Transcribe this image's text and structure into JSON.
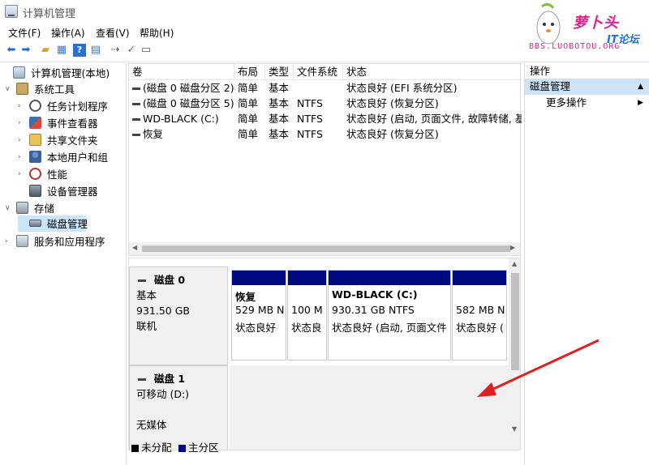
{
  "window": {
    "title": "计算机管理"
  },
  "brand": {
    "logo_main": "萝卜头",
    "logo_tag": "IT论坛",
    "url": "BBS.LUOBOTOU.ORG"
  },
  "menu": [
    "文件(F)",
    "操作(A)",
    "查看(V)",
    "帮助(H)"
  ],
  "toolbar_icons": [
    "back-icon",
    "forward-icon",
    "up-folder-icon",
    "show-hide-tree-icon",
    "help-icon",
    "properties-icon",
    "connect-icon",
    "check-icon",
    "export-icon"
  ],
  "tree": [
    {
      "label": "计算机管理(本地)",
      "icon": "computer-icon",
      "expander": "",
      "level": 0
    },
    {
      "label": "系统工具",
      "icon": "tools-icon",
      "expander": "∨",
      "level": 1
    },
    {
      "label": "任务计划程序",
      "icon": "clock-icon",
      "expander": "›",
      "level": 2
    },
    {
      "label": "事件查看器",
      "icon": "event-viewer-icon",
      "expander": "›",
      "level": 2
    },
    {
      "label": "共享文件夹",
      "icon": "shared-folder-icon",
      "expander": "›",
      "level": 2
    },
    {
      "label": "本地用户和组",
      "icon": "users-icon",
      "expander": "›",
      "level": 2
    },
    {
      "label": "性能",
      "icon": "performance-icon",
      "expander": "›",
      "level": 2
    },
    {
      "label": "设备管理器",
      "icon": "device-manager-icon",
      "expander": "",
      "level": 2
    },
    {
      "label": "存储",
      "icon": "storage-icon",
      "expander": "∨",
      "level": 1
    },
    {
      "label": "磁盘管理",
      "icon": "disk-management-icon",
      "expander": "",
      "level": 2,
      "selected": true
    },
    {
      "label": "服务和应用程序",
      "icon": "services-icon",
      "expander": "›",
      "level": 1
    }
  ],
  "volume_list": {
    "headers": [
      "卷",
      "布局",
      "类型",
      "文件系统",
      "状态"
    ],
    "rows": [
      [
        "(磁盘 0 磁盘分区 2)",
        "简单",
        "基本",
        "",
        "状态良好 (EFI 系统分区)"
      ],
      [
        "(磁盘 0 磁盘分区 5)",
        "简单",
        "基本",
        "NTFS",
        "状态良好 (恢复分区)"
      ],
      [
        "WD-BLACK (C:)",
        "简单",
        "基本",
        "NTFS",
        "状态良好 (启动, 页面文件, 故障转储, 基"
      ],
      [
        "恢复",
        "简单",
        "基本",
        "NTFS",
        "状态良好 (恢复分区)"
      ]
    ]
  },
  "disks": {
    "disk0": {
      "name": "磁盘 0",
      "type": "基本",
      "size": "931.50 GB",
      "status": "联机",
      "partitions": [
        {
          "name": "恢复",
          "size": "529 MB N",
          "status": "状态良好"
        },
        {
          "name": "",
          "size": "100 M",
          "status": "状态良"
        },
        {
          "name": "WD-BLACK (C:)",
          "size": "930.31 GB NTFS",
          "status": "状态良好 (启动, 页面文件"
        },
        {
          "name": "",
          "size": "582 MB N",
          "status": "状态良好 ("
        }
      ]
    },
    "disk1": {
      "name": "磁盘 1",
      "type": "可移动 (D:)",
      "status": "无媒体"
    }
  },
  "legend": [
    {
      "label": "未分配",
      "color": "#000000"
    },
    {
      "label": "主分区",
      "color": "#000a80"
    }
  ],
  "actions": {
    "header": "操作",
    "section": "磁盘管理",
    "more": "更多操作"
  },
  "colors": {
    "partition_bar": "#000a80",
    "selection": "#cce4f7",
    "annotation_arrow": "#e02020"
  }
}
